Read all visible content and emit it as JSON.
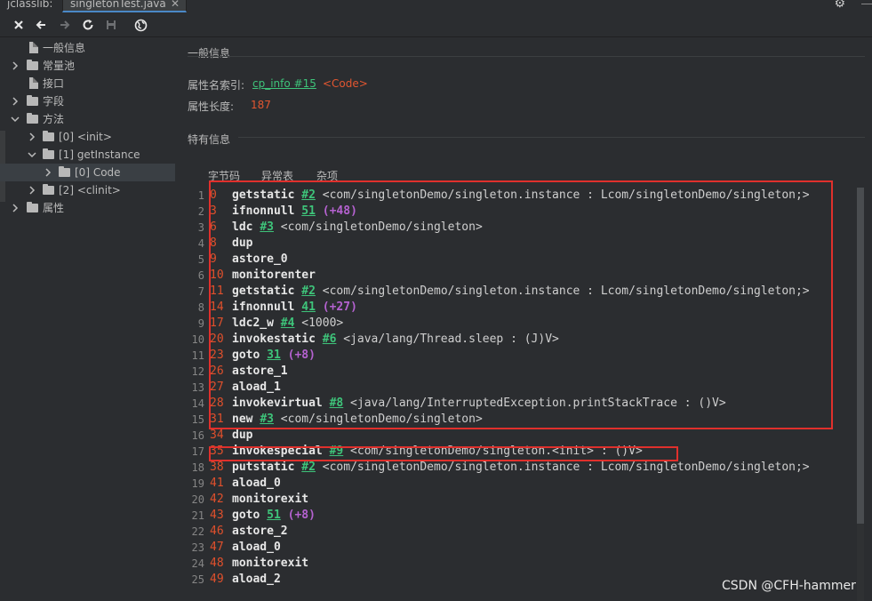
{
  "tabs": [
    {
      "label": "jclasslib:"
    },
    {
      "label": "singletonTest.java",
      "close": "✕"
    }
  ],
  "toolbar": {
    "icons": [
      "close-icon",
      "back-icon",
      "forward-icon",
      "refresh-icon",
      "save-icon",
      "web-icon"
    ]
  },
  "tree": {
    "items": [
      {
        "label": "一般信息"
      },
      {
        "label": "常量池"
      },
      {
        "label": "接口"
      },
      {
        "label": "字段"
      },
      {
        "label": "方法"
      },
      {
        "label": "[0] <init>"
      },
      {
        "label": "[1] getInstance"
      },
      {
        "label": "[0] Code"
      },
      {
        "label": "[2] <clinit>"
      },
      {
        "label": "属性"
      }
    ]
  },
  "general": {
    "title": "一般信息",
    "name_index_label": "属性名索引:",
    "name_index_link": "cp_info #15",
    "name_index_value": "<Code>",
    "length_label": "属性长度:",
    "length_value": "187"
  },
  "specific": {
    "title": "特有信息",
    "tabs": [
      "字节码",
      "异常表",
      "杂项"
    ]
  },
  "code": [
    {
      "ln": "1",
      "off": "0",
      "op": "getstatic",
      "ref": "#2",
      "rest": " <com/singletonDemo/singleton.instance : Lcom/singletonDemo/singleton;>"
    },
    {
      "ln": "2",
      "off": "3",
      "op": "ifnonnull",
      "ref": "51",
      "rel": " (+48)"
    },
    {
      "ln": "3",
      "off": "6",
      "op": "ldc",
      "ref": "#3",
      "rest": " <com/singletonDemo/singleton>"
    },
    {
      "ln": "4",
      "off": "8",
      "op": "dup"
    },
    {
      "ln": "5",
      "off": "9",
      "op": "astore_0"
    },
    {
      "ln": "6",
      "off": "10",
      "op": "monitorenter"
    },
    {
      "ln": "7",
      "off": "11",
      "op": "getstatic",
      "ref": "#2",
      "rest": " <com/singletonDemo/singleton.instance : Lcom/singletonDemo/singleton;>"
    },
    {
      "ln": "8",
      "off": "14",
      "op": "ifnonnull",
      "ref": "41",
      "rel": " (+27)"
    },
    {
      "ln": "9",
      "off": "17",
      "op": "ldc2_w",
      "ref": "#4",
      "rest": " <1000>"
    },
    {
      "ln": "10",
      "off": "20",
      "op": "invokestatic",
      "ref": "#6",
      "rest": " <java/lang/Thread.sleep : (J)V>"
    },
    {
      "ln": "11",
      "off": "23",
      "op": "goto",
      "ref": "31",
      "rel": " (+8)"
    },
    {
      "ln": "12",
      "off": "26",
      "op": "astore_1"
    },
    {
      "ln": "13",
      "off": "27",
      "op": "aload_1"
    },
    {
      "ln": "14",
      "off": "28",
      "op": "invokevirtual",
      "ref": "#8",
      "rest": " <java/lang/InterruptedException.printStackTrace : ()V>"
    },
    {
      "ln": "15",
      "off": "31",
      "op": "new",
      "ref": "#3",
      "rest": " <com/singletonDemo/singleton>"
    },
    {
      "ln": "16",
      "off": "34",
      "op": "dup"
    },
    {
      "ln": "17",
      "off": "35",
      "op": "invokespecial",
      "ref": "#9",
      "rest": " <com/singletonDemo/singleton.<init> : ()V>"
    },
    {
      "ln": "18",
      "off": "38",
      "op": "putstatic",
      "ref": "#2",
      "rest": " <com/singletonDemo/singleton.instance : Lcom/singletonDemo/singleton;>"
    },
    {
      "ln": "19",
      "off": "41",
      "op": "aload_0"
    },
    {
      "ln": "20",
      "off": "42",
      "op": "monitorexit"
    },
    {
      "ln": "21",
      "off": "43",
      "op": "goto",
      "ref": "51",
      "rel": " (+8)"
    },
    {
      "ln": "22",
      "off": "46",
      "op": "astore_2"
    },
    {
      "ln": "23",
      "off": "47",
      "op": "aload_0"
    },
    {
      "ln": "24",
      "off": "48",
      "op": "monitorexit"
    },
    {
      "ln": "25",
      "off": "49",
      "op": "aload_2"
    }
  ],
  "watermark": "CSDN @CFH-hammer",
  "colors": {
    "background": "#2b2d30",
    "offset": "#e0502c",
    "reference": "#3ec47a",
    "relative": "#b562d0",
    "highlight_box": "#e0302c"
  }
}
